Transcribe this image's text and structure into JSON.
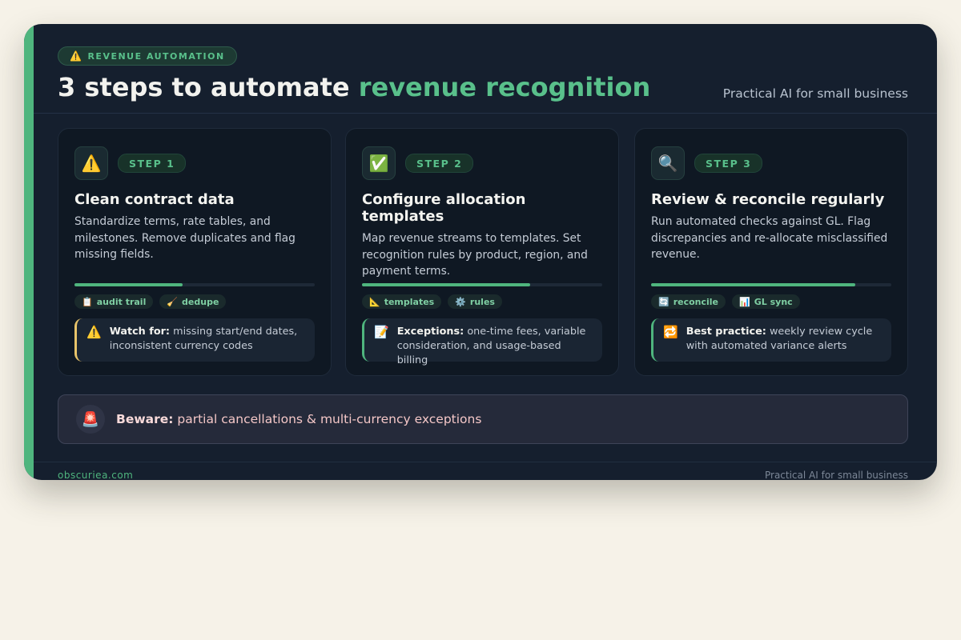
{
  "header": {
    "badge_icon": "⚠️",
    "badge_text": "REVENUE AUTOMATION",
    "title_main": "3 steps to automate ",
    "title_highlight": "revenue recognition",
    "tagline": "Practical AI for small business"
  },
  "steps": [
    {
      "icon": "⚠️",
      "icon_name": "warning-icon",
      "label": "STEP 1",
      "title": "Clean contract data",
      "description": "Standardize terms, rate tables, and milestones. Remove duplicates and flag missing fields.",
      "progress": 0.45,
      "chips": [
        {
          "icon": "📋",
          "icon_name": "clipboard-icon",
          "label": "audit trail"
        },
        {
          "icon": "🧹",
          "icon_name": "broom-icon",
          "label": "dedupe"
        }
      ],
      "note": {
        "icon": "⚠️",
        "icon_name": "warning-icon",
        "label": "Watch for:",
        "text": " missing start/end dates, inconsistent currency codes"
      }
    },
    {
      "icon": "✅",
      "icon_name": "check-icon",
      "label": "STEP 2",
      "title": "Configure allocation templates",
      "description": "Map revenue streams to templates. Set recognition rules by product, region, and payment terms.",
      "progress": 0.7,
      "chips": [
        {
          "icon": "📐",
          "icon_name": "ruler-icon",
          "label": "templates"
        },
        {
          "icon": "⚙️",
          "icon_name": "gear-icon",
          "label": "rules"
        }
      ],
      "note": {
        "icon": "📝",
        "icon_name": "memo-icon",
        "label": "Exceptions:",
        "text": " one-time fees, variable consideration, and usage-based billing"
      }
    },
    {
      "icon": "🔍",
      "icon_name": "magnifier-icon",
      "label": "STEP 3",
      "title": "Review & reconcile regularly",
      "description": "Run automated checks against GL. Flag discrepancies and re-allocate misclassified revenue.",
      "progress": 0.85,
      "chips": [
        {
          "icon": "🔄",
          "icon_name": "sync-icon",
          "label": "reconcile"
        },
        {
          "icon": "📊",
          "icon_name": "bar-chart-icon",
          "label": "GL sync"
        }
      ],
      "note": {
        "icon": "🔁",
        "icon_name": "repeat-icon",
        "label": "Best practice:",
        "text": " weekly review cycle with automated variance alerts"
      }
    }
  ],
  "beware": {
    "icon": "🚨",
    "label": "Beware:",
    "text": " partial cancellations & multi-currency exceptions"
  },
  "footer": {
    "left": "obscuriea.com",
    "right": "Practical AI for small business"
  },
  "colors": {
    "accent": "#4fb57e",
    "background": "#151f2e",
    "warning": "#e8c46a"
  }
}
